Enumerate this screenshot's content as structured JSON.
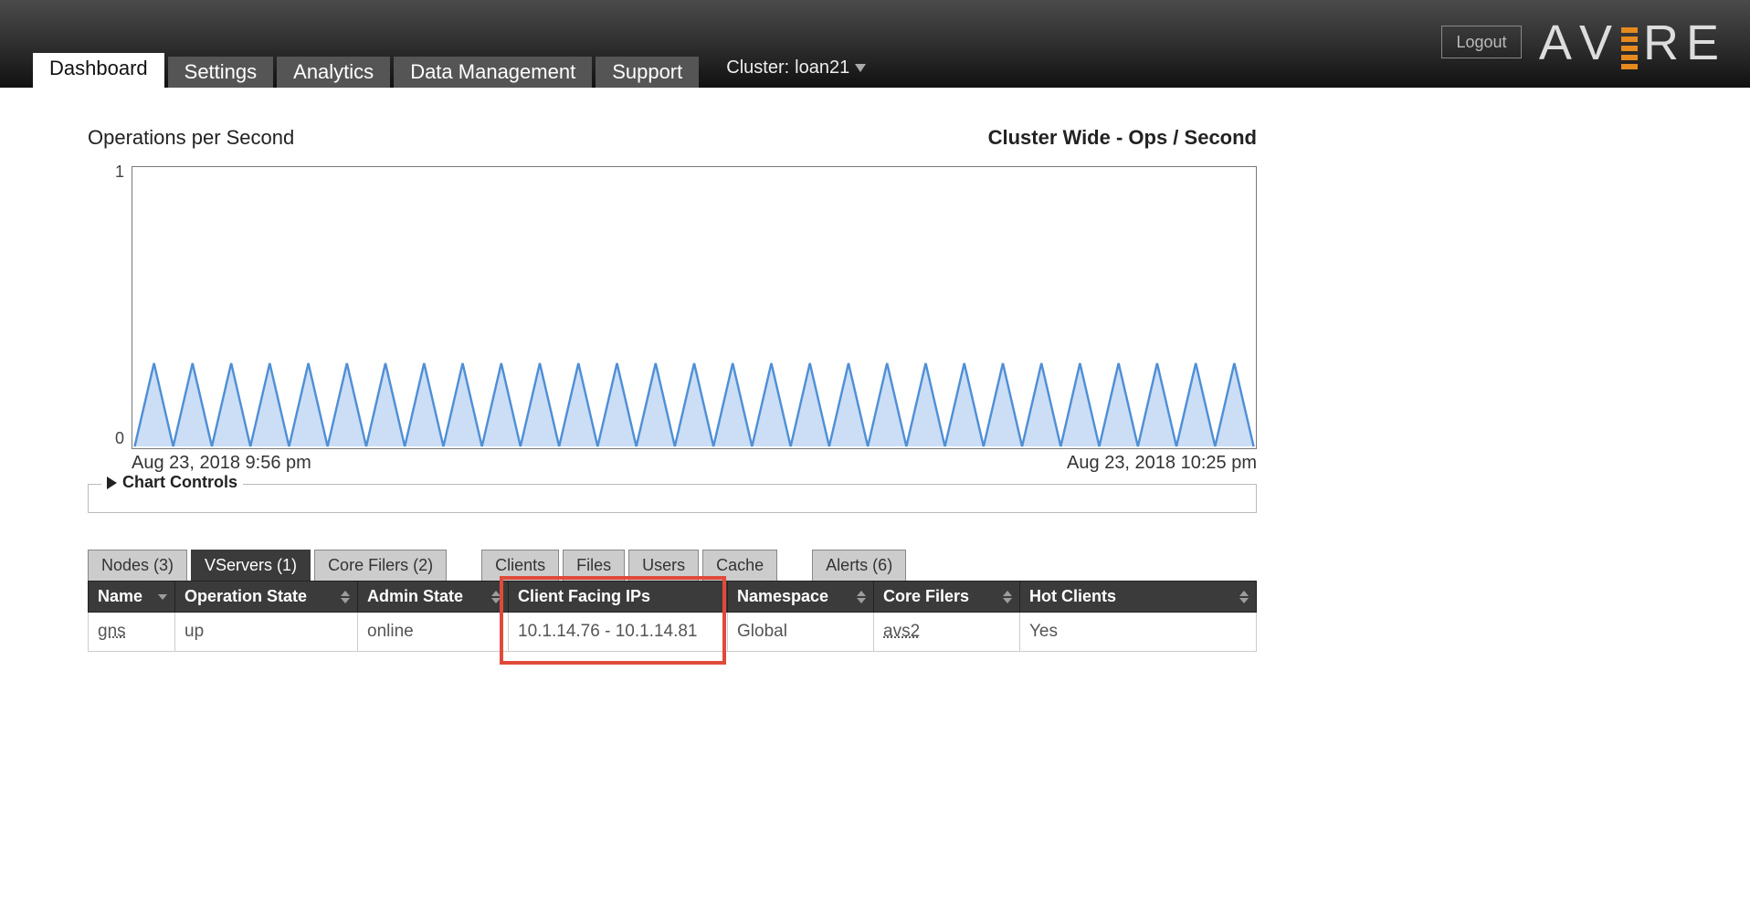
{
  "header": {
    "logout": "Logout",
    "cluster_label": "Cluster:",
    "cluster_name": "loan21",
    "tabs": [
      "Dashboard",
      "Settings",
      "Analytics",
      "Data Management",
      "Support"
    ],
    "active_tab_index": 0,
    "logo_letters": [
      "A",
      "V",
      "R",
      "E"
    ]
  },
  "chart": {
    "title_left": "Operations per Second",
    "title_right": "Cluster Wide - Ops / Second",
    "ytick_low": "0",
    "ytick_high": "1",
    "x_start": "Aug 23, 2018 9:56 pm",
    "x_end": "Aug 23, 2018 10:25 pm",
    "controls_label": "Chart Controls"
  },
  "chart_data": {
    "type": "line",
    "title": "Operations per Second",
    "xlabel_start": "Aug 23, 2018 9:56 pm",
    "xlabel_end": "Aug 23, 2018 10:25 pm",
    "ylabel": "Ops / Second",
    "ylim": [
      0,
      1
    ],
    "series": [
      {
        "name": "Cluster Wide",
        "values": [
          0,
          0.3,
          0,
          0.3,
          0,
          0.3,
          0,
          0.3,
          0,
          0.3,
          0,
          0.3,
          0,
          0.3,
          0,
          0.3,
          0,
          0.3,
          0,
          0.3,
          0,
          0.3,
          0,
          0.3,
          0,
          0.3,
          0,
          0.3,
          0,
          0.3,
          0,
          0.3,
          0,
          0.3,
          0,
          0.3,
          0,
          0.3,
          0,
          0.3,
          0,
          0.3,
          0,
          0.3,
          0,
          0.3,
          0,
          0.3,
          0,
          0.3,
          0,
          0.3,
          0,
          0.3,
          0,
          0.3,
          0,
          0.3,
          0
        ]
      }
    ]
  },
  "lower_tabs": {
    "group1": [
      "Nodes (3)",
      "VServers (1)",
      "Core Filers (2)"
    ],
    "group1_active": 1,
    "group2": [
      "Clients",
      "Files",
      "Users",
      "Cache"
    ],
    "group3": [
      "Alerts (6)"
    ]
  },
  "table": {
    "columns": [
      "Name",
      "Operation State",
      "Admin State",
      "Client Facing IPs",
      "Namespace",
      "Core Filers",
      "Hot Clients"
    ],
    "rows": [
      {
        "name": "gns",
        "operation_state": "up",
        "admin_state": "online",
        "client_facing_ips": "10.1.14.76 - 10.1.14.81",
        "namespace": "Global",
        "core_filers": "avs2",
        "hot_clients": "Yes"
      }
    ],
    "highlight_col_index": 3
  }
}
